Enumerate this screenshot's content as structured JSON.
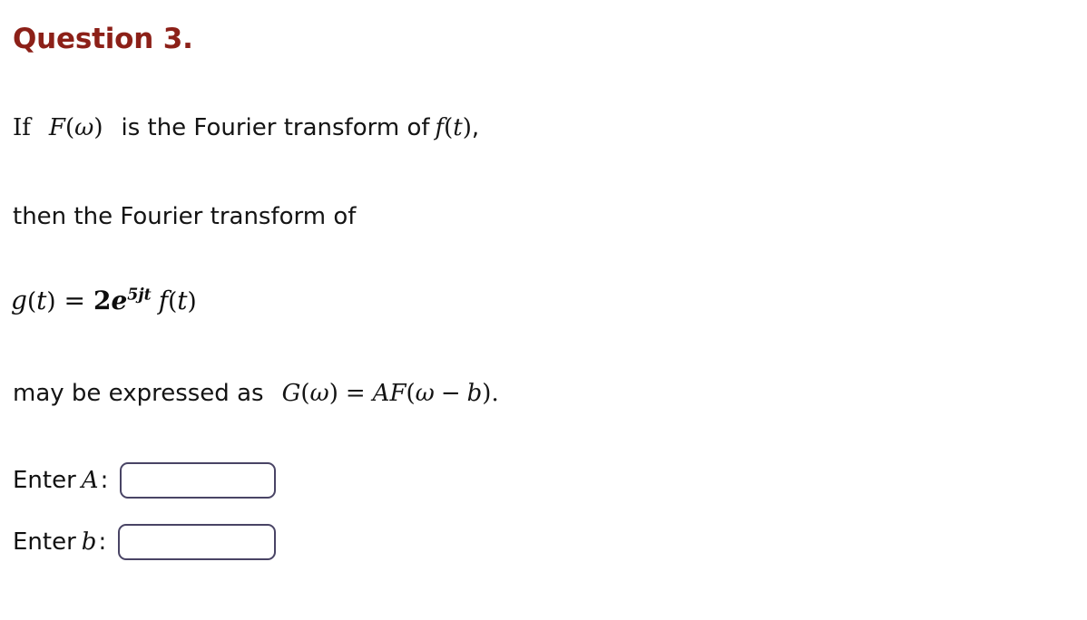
{
  "page": {
    "background": "#ffffff",
    "title_color": "#8c2018",
    "text_color": "#111111",
    "input_border_color": "#494465"
  },
  "question": {
    "title": "Question 3.",
    "number": "3"
  },
  "statement": {
    "line1": {
      "lead": "If",
      "math_F": "F(ω)",
      "F_name": "F",
      "F_arg": "ω",
      "mid_text": "is the Fourier transform of",
      "math_f": "f(t)",
      "f_name": "f",
      "f_arg": "t",
      "trailing": ","
    },
    "line2": {
      "text": "then the Fourier transform of"
    },
    "equation": {
      "latex": "g(t) = 2e^{5jt} f(t)",
      "lhs_name": "g",
      "lhs_arg": "t",
      "equals": "=",
      "coefficient": "2",
      "exp_base": "e",
      "exponent": "5jt",
      "factor_name": "f",
      "factor_arg": "t"
    },
    "line4": {
      "text": "may be expressed as",
      "result_latex": "G(ω) = AF(ω − b).",
      "G_name": "G",
      "G_arg": "ω",
      "equals": "=",
      "A_sym": "A",
      "F_sym": "F",
      "inner_arg": "ω",
      "minus": "−",
      "b_sym": "b",
      "period": "."
    }
  },
  "answers": {
    "rows": [
      {
        "label_prefix": "Enter",
        "symbol": "A",
        "colon": ":",
        "value": "",
        "placeholder": ""
      },
      {
        "label_prefix": "Enter",
        "symbol": "b",
        "colon": ":",
        "value": "",
        "placeholder": ""
      }
    ]
  }
}
